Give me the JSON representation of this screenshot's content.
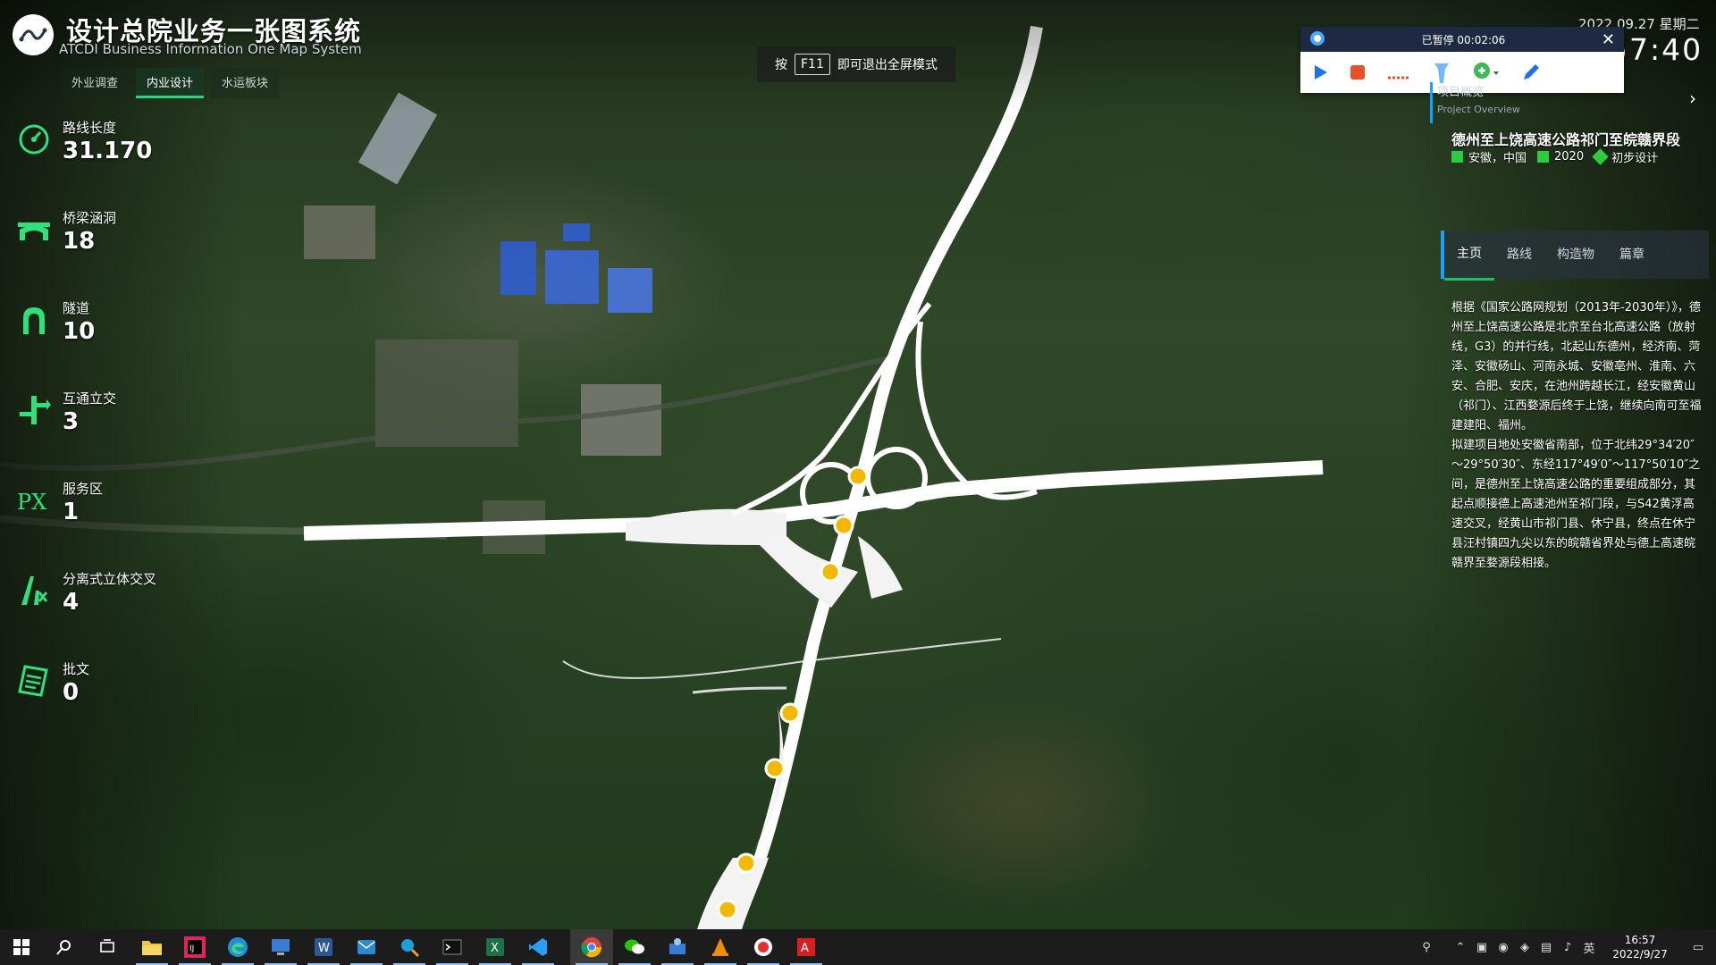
{
  "app": {
    "title": "设计总院业务一张图系统",
    "subtitle": "ATCDI Business Information One Map System"
  },
  "nav_tabs": [
    {
      "label": "外业调查"
    },
    {
      "label": "内业设计"
    },
    {
      "label": "水运板块"
    }
  ],
  "stats": [
    {
      "label": "路线长度",
      "value": "31.170",
      "icon": "gauge-icon"
    },
    {
      "label": "桥梁涵洞",
      "value": "18",
      "icon": "bridge-icon"
    },
    {
      "label": "隧道",
      "value": "10",
      "icon": "tunnel-icon"
    },
    {
      "label": "互通立交",
      "value": "3",
      "icon": "interchange-icon"
    },
    {
      "label": "服务区",
      "value": "1",
      "icon": "px-icon"
    },
    {
      "label": "分离式立体交叉",
      "value": "4",
      "icon": "overpass-icon"
    },
    {
      "label": "批文",
      "value": "0",
      "icon": "document-icon"
    }
  ],
  "fullscreen_hint": {
    "prefix": "按",
    "key": "F11",
    "suffix": "即可退出全屏模式"
  },
  "datetime": {
    "date": "2022.09.27 星期二",
    "time": "57:40"
  },
  "recorder": {
    "status": "已暂停 00:02:06"
  },
  "overview": {
    "label": "项目概览",
    "sublabel": "Project Overview",
    "project_name": "德州至上饶高速公路祁门至皖赣界段",
    "location": "安徽，中国",
    "year": "2020",
    "stage": "初步设计"
  },
  "right_tabs": [
    {
      "label": "主页"
    },
    {
      "label": "路线"
    },
    {
      "label": "构造物"
    },
    {
      "label": "篇章"
    }
  ],
  "description": {
    "p1": "根据《国家公路网规划（2013年-2030年）》，德州至上饶高速公路是北京至台北高速公路（放射线，G3）的并行线，北起山东德州，经济南、菏泽、安徽砀山、河南永城、安徽亳州、淮南、六安、合肥、安庆，在池州跨越长江，经安徽黄山（祁门）、江西婺源后终于上饶，继续向南可至福建建阳、福州。",
    "p2": "拟建项目地处安徽省南部，位于北纬29°34′20″～29°50′30″、东经117°49′0″～117°50′10″之间，是德州至上饶高速公路的重要组成部分，其起点顺接德上高速池州至祁门段，与S42黄浮高速交叉，经黄山市祁门县、休宁县，终点在休宁县汪村镇四九尖以东的皖赣省界处与德上高速皖赣界至婺源段相接。"
  },
  "taskbar": {
    "apps": [
      "file-explorer-icon",
      "jetbrains-icon",
      "edge-icon",
      "remote-desktop-icon",
      "word-icon",
      "outlook-icon",
      "search-app-icon",
      "terminal-icon",
      "excel-icon",
      "vscode-icon",
      "chrome-icon",
      "wechat-icon",
      "network-icon",
      "vlc-icon",
      "screen-recorder-icon",
      "acrobat-icon"
    ],
    "ime": "英",
    "clock_time": "16:57",
    "clock_date": "2022/9/27"
  },
  "colors": {
    "accent_green": "#2fe07c",
    "accent_blue": "#1aa0ff",
    "marker_yellow": "#f5b800"
  }
}
